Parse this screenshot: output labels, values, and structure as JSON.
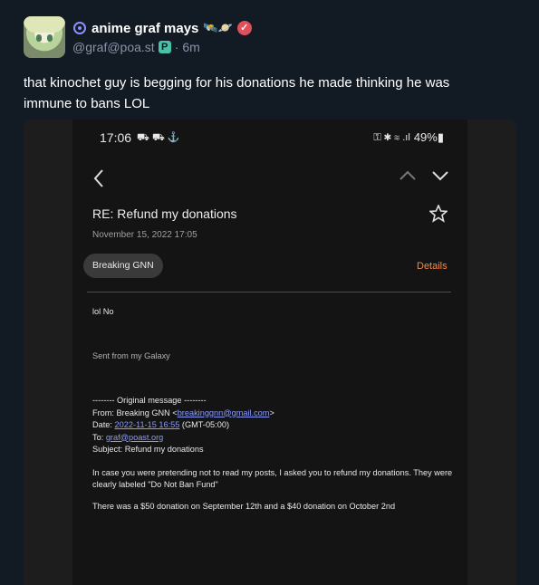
{
  "post": {
    "display_name": "anime graf mays",
    "emojis": "🛰️🪐",
    "verified_glyph": "✓",
    "handle": "@graf@poa.st",
    "instance_glyph": "P",
    "time": "6m",
    "text": "that kinochet guy is begging for his donations he made thinking he was immune to bans LOL"
  },
  "phone": {
    "status_time": "17:06",
    "status_left_icons": "⛟ ⛟ ⚓",
    "status_right_icons": "⚿ ✱ ≋ .ıl",
    "battery": "49%▮"
  },
  "email": {
    "subject": "RE: Refund my donations",
    "date": "November 15, 2022  17:05",
    "sender_chip": "Breaking GNN",
    "details_label": "Details",
    "line_reply": "lol No",
    "line_sent": "Sent from my Galaxy",
    "orig_header": "-------- Original message --------",
    "from_prefix": "From: Breaking GNN <",
    "from_email": "breakinggnn@gmail.com",
    "from_suffix": ">",
    "date_prefix": "Date: ",
    "date_link": "2022-11-15 16:55",
    "date_suffix": " (GMT-05:00)",
    "to_prefix": "To: ",
    "to_link": "graf@poast.org",
    "subject_line": "Subject: Refund my donations",
    "para1": "In case you were pretending not to read my posts, I asked you to refund my donations. They were clearly labeled \"Do Not Ban Fund\"",
    "para2": "There was a $50 donation on September 12th and a $40 donation on October 2nd"
  }
}
